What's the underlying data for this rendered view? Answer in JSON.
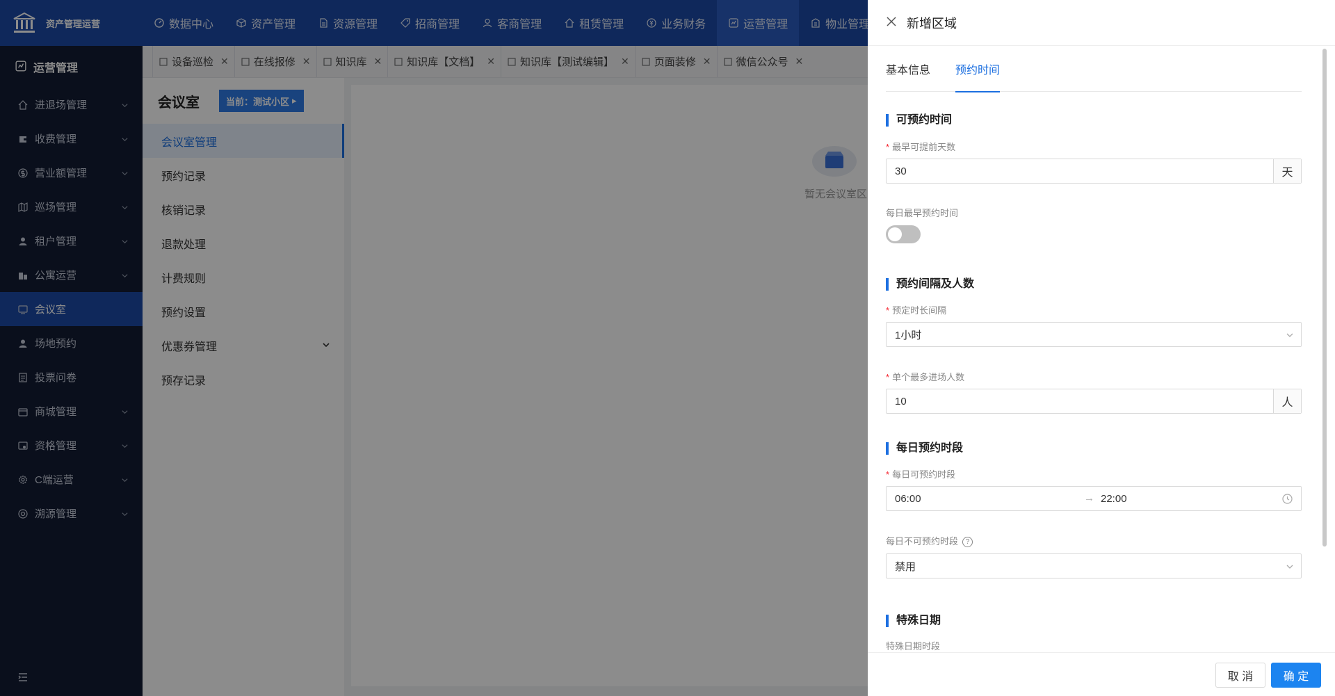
{
  "app": {
    "title": "资产管理运营"
  },
  "topnav": [
    {
      "label": "数据中心",
      "icon": "dashboard-icon"
    },
    {
      "label": "资产管理",
      "icon": "cube-icon"
    },
    {
      "label": "资源管理",
      "icon": "document-icon"
    },
    {
      "label": "招商管理",
      "icon": "tag-icon"
    },
    {
      "label": "客商管理",
      "icon": "users-icon"
    },
    {
      "label": "租赁管理",
      "icon": "home-icon"
    },
    {
      "label": "业务财务",
      "icon": "coin-icon"
    },
    {
      "label": "运营管理",
      "icon": "chart-icon",
      "active": true
    },
    {
      "label": "物业管理",
      "icon": "building-icon"
    }
  ],
  "sidebar": {
    "header": "运营管理",
    "items": [
      {
        "label": "进退场管理",
        "icon": "home-icon",
        "chevron": true
      },
      {
        "label": "收费管理",
        "icon": "wallet-icon",
        "chevron": true
      },
      {
        "label": "营业额管理",
        "icon": "dollar-icon",
        "chevron": true
      },
      {
        "label": "巡场管理",
        "icon": "map-icon",
        "chevron": true
      },
      {
        "label": "租户管理",
        "icon": "user-icon",
        "chevron": true
      },
      {
        "label": "公寓运营",
        "icon": "apartment-icon",
        "chevron": true
      },
      {
        "label": "会议室",
        "icon": "meeting-icon",
        "chevron": false,
        "active": true
      },
      {
        "label": "场地预约",
        "icon": "person-icon",
        "chevron": false
      },
      {
        "label": "投票问卷",
        "icon": "form-icon",
        "chevron": false
      },
      {
        "label": "商城管理",
        "icon": "shop-icon",
        "chevron": true
      },
      {
        "label": "资格管理",
        "icon": "badge-icon",
        "chevron": true
      },
      {
        "label": "C端运营",
        "icon": "gear-icon",
        "chevron": true
      },
      {
        "label": "溯源管理",
        "icon": "target-icon",
        "chevron": true
      }
    ]
  },
  "tabs": [
    {
      "label": "设备巡检"
    },
    {
      "label": "在线报修"
    },
    {
      "label": "知识库"
    },
    {
      "label": "知识库【文档】"
    },
    {
      "label": "知识库【测试编辑】"
    },
    {
      "label": "页面装修"
    },
    {
      "label": "微信公众号"
    }
  ],
  "subnav": {
    "title": "会议室",
    "current": "当前：测试小区",
    "items": [
      {
        "label": "会议室管理",
        "active": true
      },
      {
        "label": "预约记录"
      },
      {
        "label": "核销记录"
      },
      {
        "label": "退款处理"
      },
      {
        "label": "计费规则"
      },
      {
        "label": "预约设置"
      },
      {
        "label": "优惠券管理",
        "chevron": true
      },
      {
        "label": "预存记录"
      }
    ]
  },
  "main": {
    "empty_text": "暂无会议室区"
  },
  "drawer": {
    "title": "新增区域",
    "tabs": [
      "基本信息",
      "预约时间"
    ],
    "sections": {
      "s1": "可预约时间",
      "s2": "预约间隔及人数",
      "s3": "每日预约时段",
      "s4": "特殊日期"
    },
    "fields": {
      "advance_days_label": "最早可提前天数",
      "advance_days_value": "30",
      "advance_days_unit": "天",
      "earliest_time_label": "每日最早预约时间",
      "earliest_time_enabled": false,
      "duration_label": "预定时长间隔",
      "duration_value": "1小时",
      "max_people_label": "单个最多进场人数",
      "max_people_value": "10",
      "max_people_unit": "人",
      "daily_slot_label": "每日可预约时段",
      "daily_start": "06:00",
      "daily_arrow": "→",
      "daily_end": "22:00",
      "unavailable_label": "每日不可预约时段",
      "unavailable_value": "禁用",
      "special_label": "特殊日期时段"
    },
    "buttons": {
      "cancel": "取 消",
      "ok": "确 定"
    }
  },
  "colors": {
    "primary": "#1c6fe0",
    "topbar": "#1c4aa6",
    "sidebar": "#131c33"
  }
}
